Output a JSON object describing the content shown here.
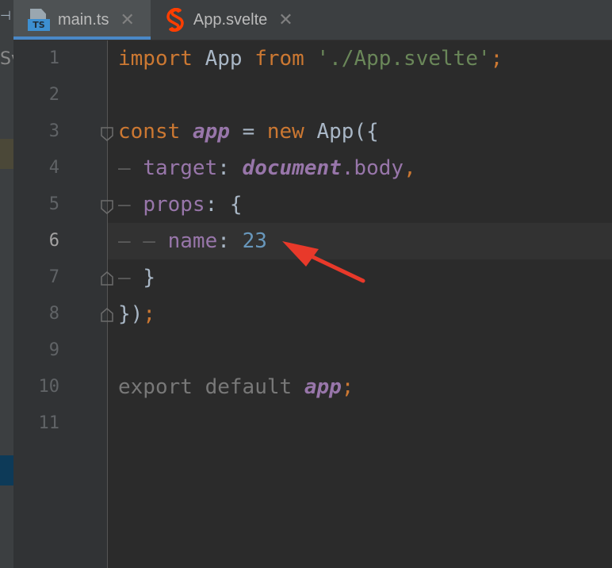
{
  "tabs": [
    {
      "label": "main.ts",
      "icon": "typescript-file-icon",
      "badge": "TS",
      "active": true
    },
    {
      "label": "App.svelte",
      "icon": "svelte-icon",
      "active": false
    }
  ],
  "left_panel": {
    "label": "Sv"
  },
  "current_line": 6,
  "gutter": {
    "line_numbers": [
      "1",
      "2",
      "3",
      "4",
      "5",
      "6",
      "7",
      "8",
      "9",
      "10",
      "11"
    ]
  },
  "code": {
    "l1": {
      "import": "import",
      "app": "App",
      "from": "from",
      "path": "'./App.svelte'",
      "semi": ";"
    },
    "l3": {
      "const": "const",
      "var": "app",
      "eq": "=",
      "new": "new",
      "call": "App({"
    },
    "l4": {
      "key": "target",
      "colon": ":",
      "obj": "document",
      "rest": ".body",
      "comma": ","
    },
    "l5": {
      "key": "props",
      "rest": ": {"
    },
    "l6": {
      "key": "name",
      "colon": ":",
      "value": "23"
    },
    "l7": {
      "text": "}"
    },
    "l8": {
      "text": "})",
      "semi": ";"
    },
    "l10": {
      "export": "export",
      "default": "default",
      "var": "app",
      "semi": ";"
    }
  },
  "colors": {
    "background": "#2b2b2b",
    "keyword": "#cc7832",
    "string": "#6a8759",
    "number": "#6897bb",
    "instance_var": "#9876aa",
    "default_text": "#a9b7c6",
    "annotation_arrow": "#e8392a"
  }
}
